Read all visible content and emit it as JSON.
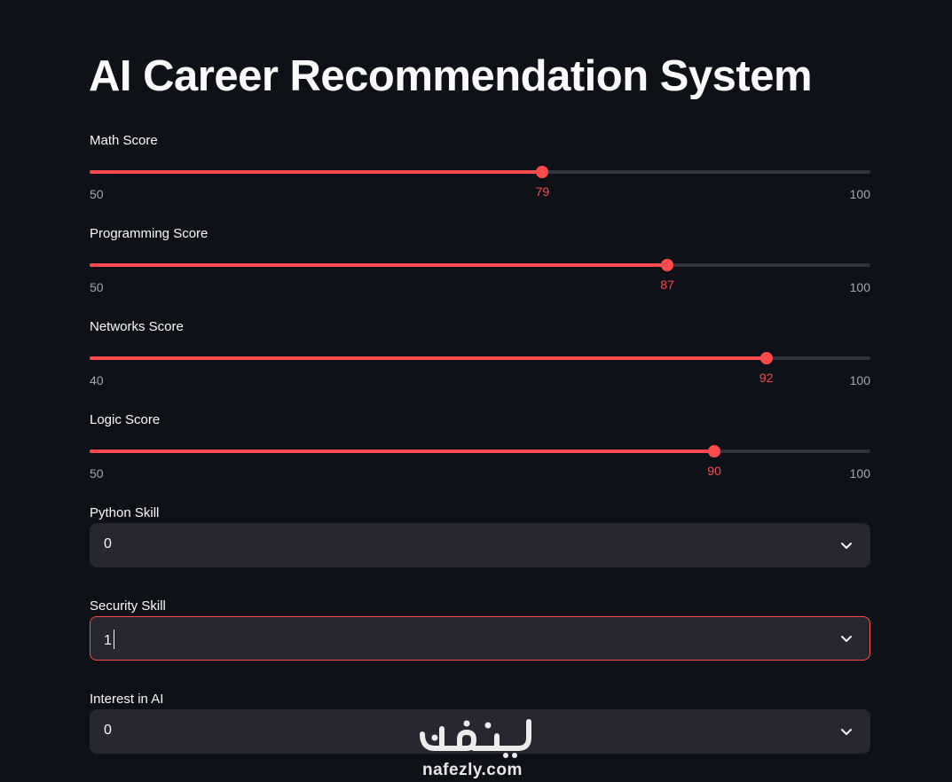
{
  "page": {
    "title": "AI Career Recommendation System"
  },
  "sliders": [
    {
      "label": "Math Score",
      "value": 79,
      "min": 50,
      "max": 100
    },
    {
      "label": "Programming Score",
      "value": 87,
      "min": 50,
      "max": 100
    },
    {
      "label": "Networks Score",
      "value": 92,
      "min": 40,
      "max": 100
    },
    {
      "label": "Logic Score",
      "value": 90,
      "min": 50,
      "max": 100
    }
  ],
  "selects": [
    {
      "label": "Python Skill",
      "value": "0",
      "focused": false
    },
    {
      "label": "Security Skill",
      "value": "1",
      "focused": true
    },
    {
      "label": "Interest in AI",
      "value": "0",
      "focused": false
    }
  ],
  "watermark": {
    "logo_text": "نفذلي",
    "site": "nafezly.com"
  },
  "colors": {
    "accent": "#ff4b4b",
    "background": "#0e1117",
    "input_background": "#262730",
    "track": "#31333f",
    "muted_text": "#a3a8b4"
  },
  "icons": {
    "select_indicator": "chevron-down-icon"
  }
}
